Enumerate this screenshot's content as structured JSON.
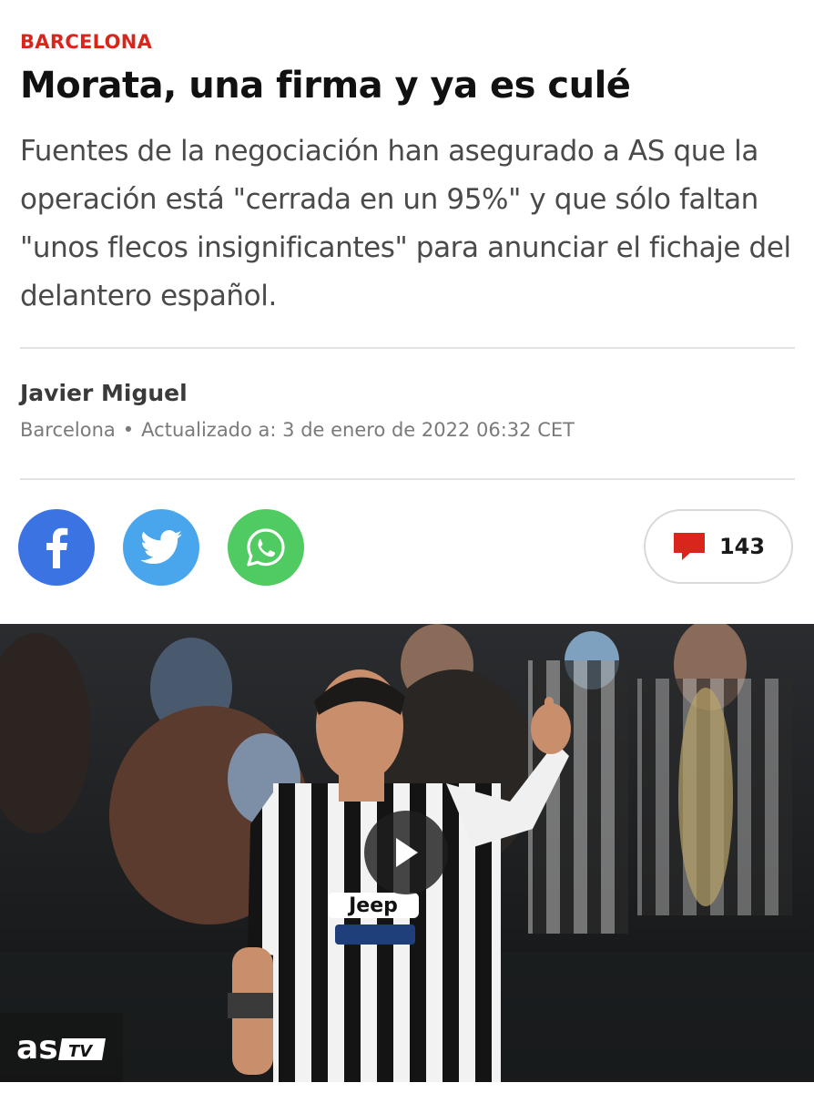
{
  "article": {
    "section": "BARCELONA",
    "headline": "Morata, una firma y ya es culé",
    "subtitle": "Fuentes de la negociación han asegurado a AS que la operación está \"cerrada en un 95%\" y que sólo faltan \"unos flecos insignificantes\" para anunciar el fichaje del delantero español."
  },
  "byline": {
    "author": "Javier Miguel",
    "location": "Barcelona",
    "separator": "•",
    "updated": "Actualizado a: 3 de enero de 2022 06:32 CET"
  },
  "share": [
    {
      "network": "facebook",
      "icon": "facebook-icon",
      "color": "#3b73e3"
    },
    {
      "network": "twitter",
      "icon": "twitter-icon",
      "color": "#4aa6ec"
    },
    {
      "network": "whatsapp",
      "icon": "whatsapp-icon",
      "color": "#4fcb62"
    }
  ],
  "comments": {
    "icon": "comment-bubble-icon",
    "count": "143",
    "color": "#d8261c"
  },
  "video": {
    "play_icon": "play-icon",
    "watermark": "as TV"
  },
  "colors": {
    "accent": "#d8261c",
    "text": "#111111",
    "muted": "#7a7a7a"
  }
}
